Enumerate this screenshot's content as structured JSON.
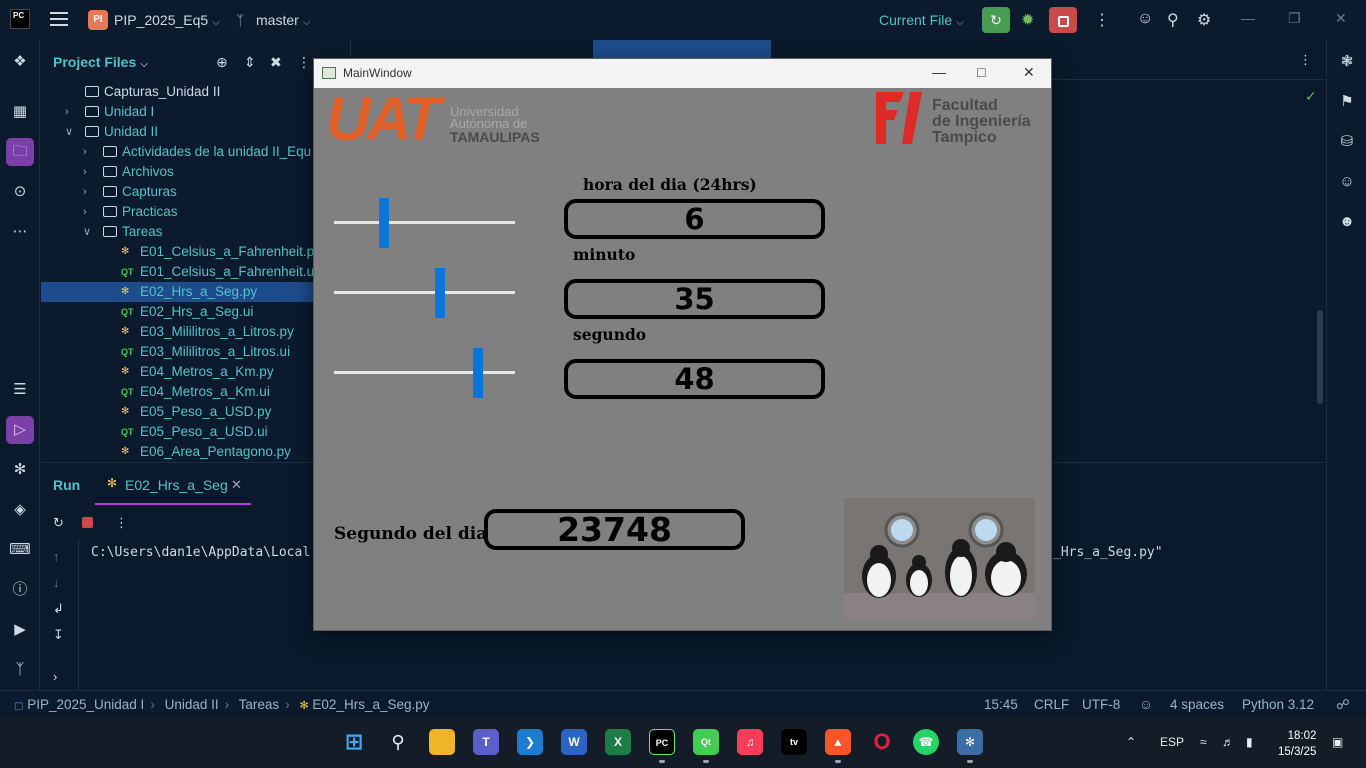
{
  "ide": {
    "logo": "PC",
    "project_badge": "PI",
    "project_name": "PIP_2025_Eq5",
    "branch": "master",
    "run_config": "Current File",
    "colors": {
      "accent": "#4fc3c7",
      "selection": "#1d4c8c",
      "run_green": "#499c54",
      "stop_red": "#c94a4a",
      "background": "#0a1a2c"
    }
  },
  "project_panel": {
    "title": "Project Files",
    "tree": [
      {
        "label": "Capturas_Unidad II",
        "type": "folder",
        "depth": 1,
        "expanded": null
      },
      {
        "label": "Unidad I",
        "type": "folder",
        "depth": 1,
        "expanded": false
      },
      {
        "label": "Unidad II",
        "type": "folder",
        "depth": 1,
        "expanded": true
      },
      {
        "label": "Actividades de la unidad II_Equ",
        "type": "folder",
        "depth": 2,
        "expanded": false
      },
      {
        "label": "Archivos",
        "type": "folder",
        "depth": 2,
        "expanded": false
      },
      {
        "label": "Capturas",
        "type": "folder",
        "depth": 2,
        "expanded": false
      },
      {
        "label": "Practicas",
        "type": "folder",
        "depth": 2,
        "expanded": false
      },
      {
        "label": "Tareas",
        "type": "folder",
        "depth": 2,
        "expanded": true
      },
      {
        "label": "E01_Celsius_a_Fahrenheit.py",
        "type": "py",
        "depth": 3
      },
      {
        "label": "E01_Celsius_a_Fahrenheit.ui",
        "type": "ui",
        "depth": 3
      },
      {
        "label": "E02_Hrs_a_Seg.py",
        "type": "py",
        "depth": 3,
        "selected": true
      },
      {
        "label": "E02_Hrs_a_Seg.ui",
        "type": "ui",
        "depth": 3
      },
      {
        "label": "E03_Mililitros_a_Litros.py",
        "type": "py",
        "depth": 3
      },
      {
        "label": "E03_Mililitros_a_Litros.ui",
        "type": "ui",
        "depth": 3
      },
      {
        "label": "E04_Metros_a_Km.py",
        "type": "py",
        "depth": 3
      },
      {
        "label": "E04_Metros_a_Km.ui",
        "type": "ui",
        "depth": 3
      },
      {
        "label": "E05_Peso_a_USD.py",
        "type": "py",
        "depth": 3
      },
      {
        "label": "E05_Peso_a_USD.ui",
        "type": "ui",
        "depth": 3
      },
      {
        "label": "E06_Area_Pentagono.py",
        "type": "py",
        "depth": 3
      }
    ]
  },
  "run_panel": {
    "title": "Run",
    "tab_label": "E02_Hrs_a_Seg",
    "console_left": "C:\\Users\\dan1e\\AppData\\Local",
    "console_right": "_Hrs_a_Seg.py\""
  },
  "statusbar": {
    "breadcrumb": [
      "PIP_2025_Unidad I",
      "Unidad II",
      "Tareas",
      "E02_Hrs_a_Seg.py"
    ],
    "position": "15:45",
    "line_ending": "CRLF",
    "encoding": "UTF-8",
    "indent": "4 spaces",
    "interpreter": "Python 3.12"
  },
  "taskbar": {
    "language": "ESP",
    "time": "18:02",
    "date": "15/3/25"
  },
  "main_window": {
    "title": "MainWindow",
    "logo_left": {
      "mark": "UAT",
      "line1": "Universidad",
      "line2": "Autónoma de",
      "line3": "TAMAULIPAS"
    },
    "logo_right": {
      "mark": "FI",
      "line1": "Facultad",
      "line2": "de Ingeniería",
      "line3": "Tampico"
    },
    "hour": {
      "label": "hora del dia (24hrs)",
      "value": "6",
      "slider_max": 23,
      "slider_value": 6
    },
    "minute": {
      "label": "minuto",
      "value": "35",
      "slider_max": 59,
      "slider_value": 35
    },
    "second": {
      "label": "segundo",
      "value": "48",
      "slider_max": 59,
      "slider_value": 48
    },
    "result": {
      "label": "Segundo del dia",
      "value": "23748"
    },
    "colors": {
      "background": "#808080",
      "slider_handle": "#0a74d8",
      "uat_orange": "#e0622a",
      "fi_red": "#e02a2a"
    }
  }
}
